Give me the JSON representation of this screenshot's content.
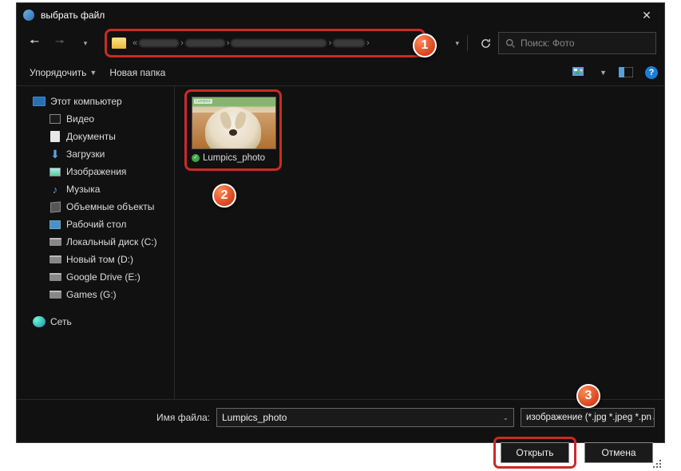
{
  "title": "выбрать файл",
  "nav": {
    "refresh_title": "Обновить",
    "search_placeholder": "Поиск: Фото"
  },
  "toolbar": {
    "organize": "Упорядочить",
    "new_folder": "Новая папка"
  },
  "tree": {
    "this_pc": "Этот компьютер",
    "videos": "Видео",
    "documents": "Документы",
    "downloads": "Загрузки",
    "pictures": "Изображения",
    "music": "Музыка",
    "objects3d": "Объемные объекты",
    "desktop": "Рабочий стол",
    "local_c": "Локальный диск (C:)",
    "vol_d": "Новый том (D:)",
    "gdrive": "Google Drive (E:)",
    "games": "Games (G:)",
    "network": "Сеть"
  },
  "file": {
    "name": "Lumpics_photo",
    "thumb_tag": "Lumpics"
  },
  "footer": {
    "filename_label": "Имя файла:",
    "filename_value": "Lumpics_photo",
    "filter": "изображение (*.jpg *.jpeg *.pn",
    "open": "Открыть",
    "cancel": "Отмена"
  },
  "callouts": {
    "c1": "1",
    "c2": "2",
    "c3": "3"
  }
}
